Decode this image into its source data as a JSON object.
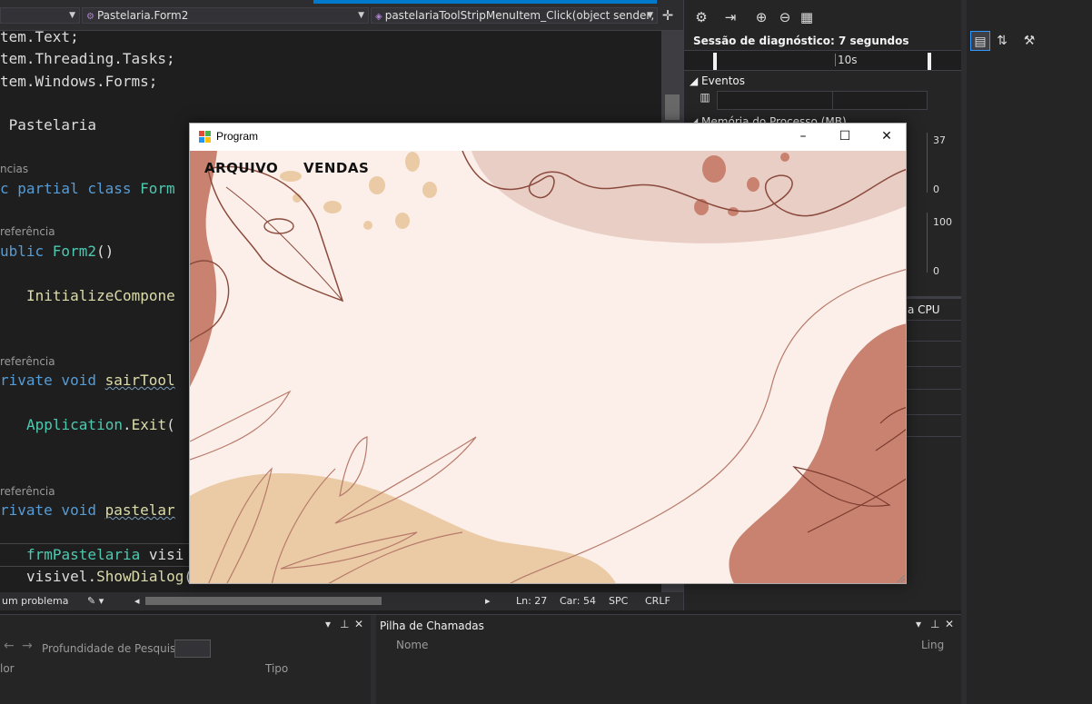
{
  "editor": {
    "nav": {
      "left": "",
      "middle": "Pastelaria.Form2",
      "right": "pastelariaToolStripMenuItem_Click(object sender, Eve"
    },
    "lines": {
      "l1": "tem.Text;",
      "l2": "tem.Threading.Tasks;",
      "l3": "tem.Windows.Forms;",
      "l4": " Pastelaria",
      "h1": "ncias",
      "l5a": "c partial class ",
      "l5b": "Form",
      "h2": "referência",
      "l6a": "ublic ",
      "l6b": "Form2",
      "l6c": "()",
      "l7": "InitializeCompone",
      "h3": "referência",
      "l8a": "rivate void ",
      "l8b": "sairTool",
      "l9a": "Application",
      "l9b": ".",
      "l9c": "Exit",
      "l9d": "(",
      "h4": "referência",
      "l10a": "rivate void ",
      "l10b": "pastelar",
      "l11a": "frmPastelaria",
      "l11b": " visi",
      "l12a": "visivel",
      "l12b": ".",
      "l12c": "ShowDialog",
      "l12d": "();"
    },
    "status": {
      "problems": "um problema",
      "ln": "Ln: 27",
      "car": "Car: 54",
      "spc": "SPC",
      "crlf": "CRLF"
    }
  },
  "diagnostics": {
    "session": "Sessão de diagnóstico: 7 segundos",
    "timeline_label": "10s",
    "events": "Eventos",
    "memory": "Memória do Processo (MB)",
    "memory_max": "37",
    "memory_min": "0",
    "cpu_max": "100",
    "cpu_min": "0",
    "cpu_tab": "a CPU"
  },
  "bottom": {
    "search_label": "Profundidade de Pesquisa:",
    "col_value": "lor",
    "col_type": "Tipo",
    "callstack_title": "Pilha de Chamadas",
    "col_name": "Nome",
    "col_lang": "Ling"
  },
  "program_window": {
    "title": "Program",
    "menu_arquivo": "ARQUIVO",
    "menu_vendas": "VENDAS",
    "minimize": "–",
    "maximize": "☐",
    "close": "✕"
  },
  "colors": {
    "accent": "#007acc",
    "bg_cream": "#fcefe9",
    "blob_terracotta": "#c98270",
    "blob_pink": "#e9cec6",
    "blob_sand": "#ebcba6",
    "line_brown": "#8a4a3c"
  }
}
